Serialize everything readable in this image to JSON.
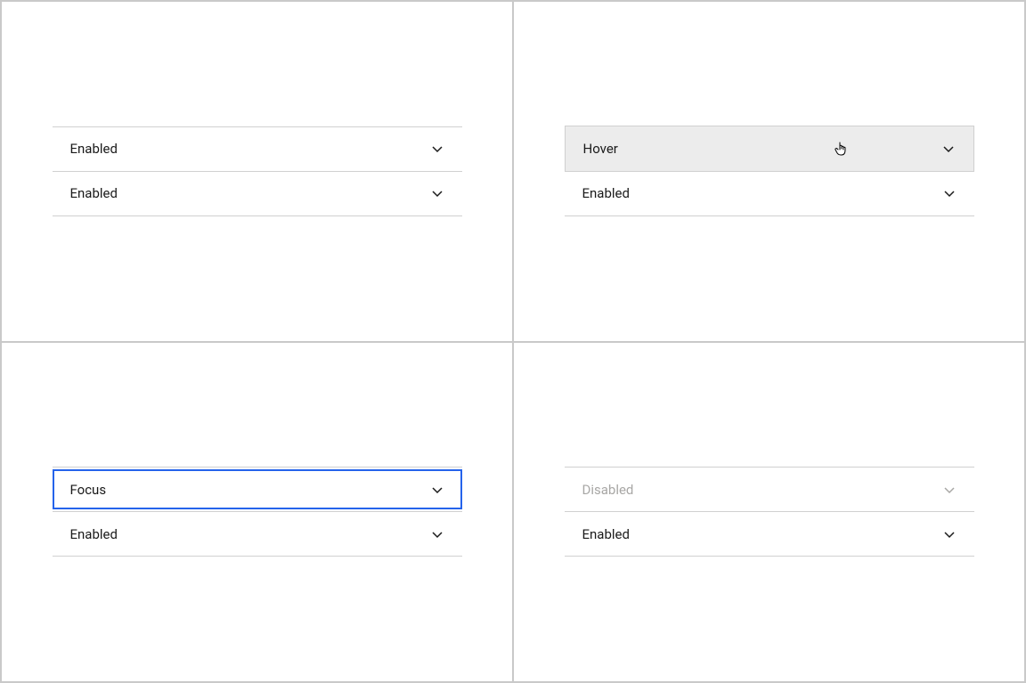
{
  "panels": {
    "enabled": {
      "row1": "Enabled",
      "row2": "Enabled"
    },
    "hover": {
      "row1": "Hover",
      "row2": "Enabled"
    },
    "focus": {
      "row1": "Focus",
      "row2": "Enabled"
    },
    "disabled": {
      "row1": "Disabled",
      "row2": "Enabled"
    }
  },
  "colors": {
    "focus_ring": "#2563eb",
    "hover_bg": "#ececec",
    "disabled_text": "#a8a7a5",
    "divider": "#d0d0d0"
  }
}
